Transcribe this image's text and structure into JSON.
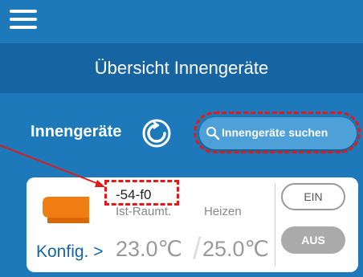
{
  "header": {
    "title": "Übersicht Innengeräte"
  },
  "section": {
    "label": "Innengeräte",
    "search_label": "Innengeräte suchen"
  },
  "device": {
    "id": "-54-f0",
    "ist_label": "Ist-Raumt.",
    "mode_label": "Heizen",
    "ist_value": "23.0℃",
    "separator": "/",
    "set_value": "25.0℃",
    "konfig_label": "Konfig. >",
    "on_label": "EIN",
    "off_label": "AUS"
  },
  "colors": {
    "app_blue": "#1d79b9",
    "title_blue": "#1665a2",
    "unit_orange": "#f07d12",
    "annotation_red": "#e01a1a"
  },
  "icons": [
    "menu-icon",
    "refresh-icon",
    "search-icon",
    "indoor-unit-icon"
  ]
}
